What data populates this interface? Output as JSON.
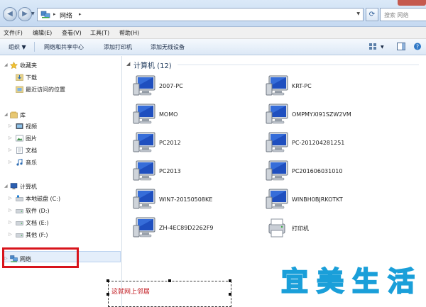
{
  "address_bar": {
    "crumb": "网络",
    "search_placeholder": "搜索 网络"
  },
  "menu": {
    "file": "文件(F)",
    "edit": "编辑(E)",
    "view": "查看(V)",
    "tools": "工具(T)",
    "help": "帮助(H)"
  },
  "toolbar": {
    "organize": "组织 ▼",
    "network_center": "网络和共享中心",
    "add_printer": "添加打印机",
    "add_wireless": "添加无线设备"
  },
  "sidebar": {
    "favorites": {
      "label": "收藏夹",
      "items": [
        "下载",
        "最近访问的位置"
      ]
    },
    "libraries": {
      "label": "库",
      "items": [
        "视频",
        "图片",
        "文档",
        "音乐"
      ]
    },
    "computer": {
      "label": "计算机",
      "items": [
        "本地磁盘 (C:)",
        "软件 (D:)",
        "文档 (E:)",
        "其他 (F:)"
      ]
    },
    "network": {
      "label": "网络"
    }
  },
  "content": {
    "group_label": "计算机 (12)",
    "computers": [
      "2007-PC",
      "KRT-PC",
      "MOMO",
      "OMPMYXI91SZW2VM",
      "PC2012",
      "PC-201204281251",
      "PC2013",
      "PC201606031010",
      "WIN7-20150508KE",
      "WINBH0BJRKOTKT",
      "ZH-4EC89D2262F9",
      "打印机"
    ]
  },
  "annotation": {
    "text": "这就网上邻居"
  },
  "watermark": {
    "chars": [
      "宜",
      "美",
      "生",
      "活"
    ]
  },
  "colors": {
    "selection_box": "#d8141c",
    "annotation_text": "#c0151b",
    "watermark_stroke": "#1a9fd9"
  }
}
